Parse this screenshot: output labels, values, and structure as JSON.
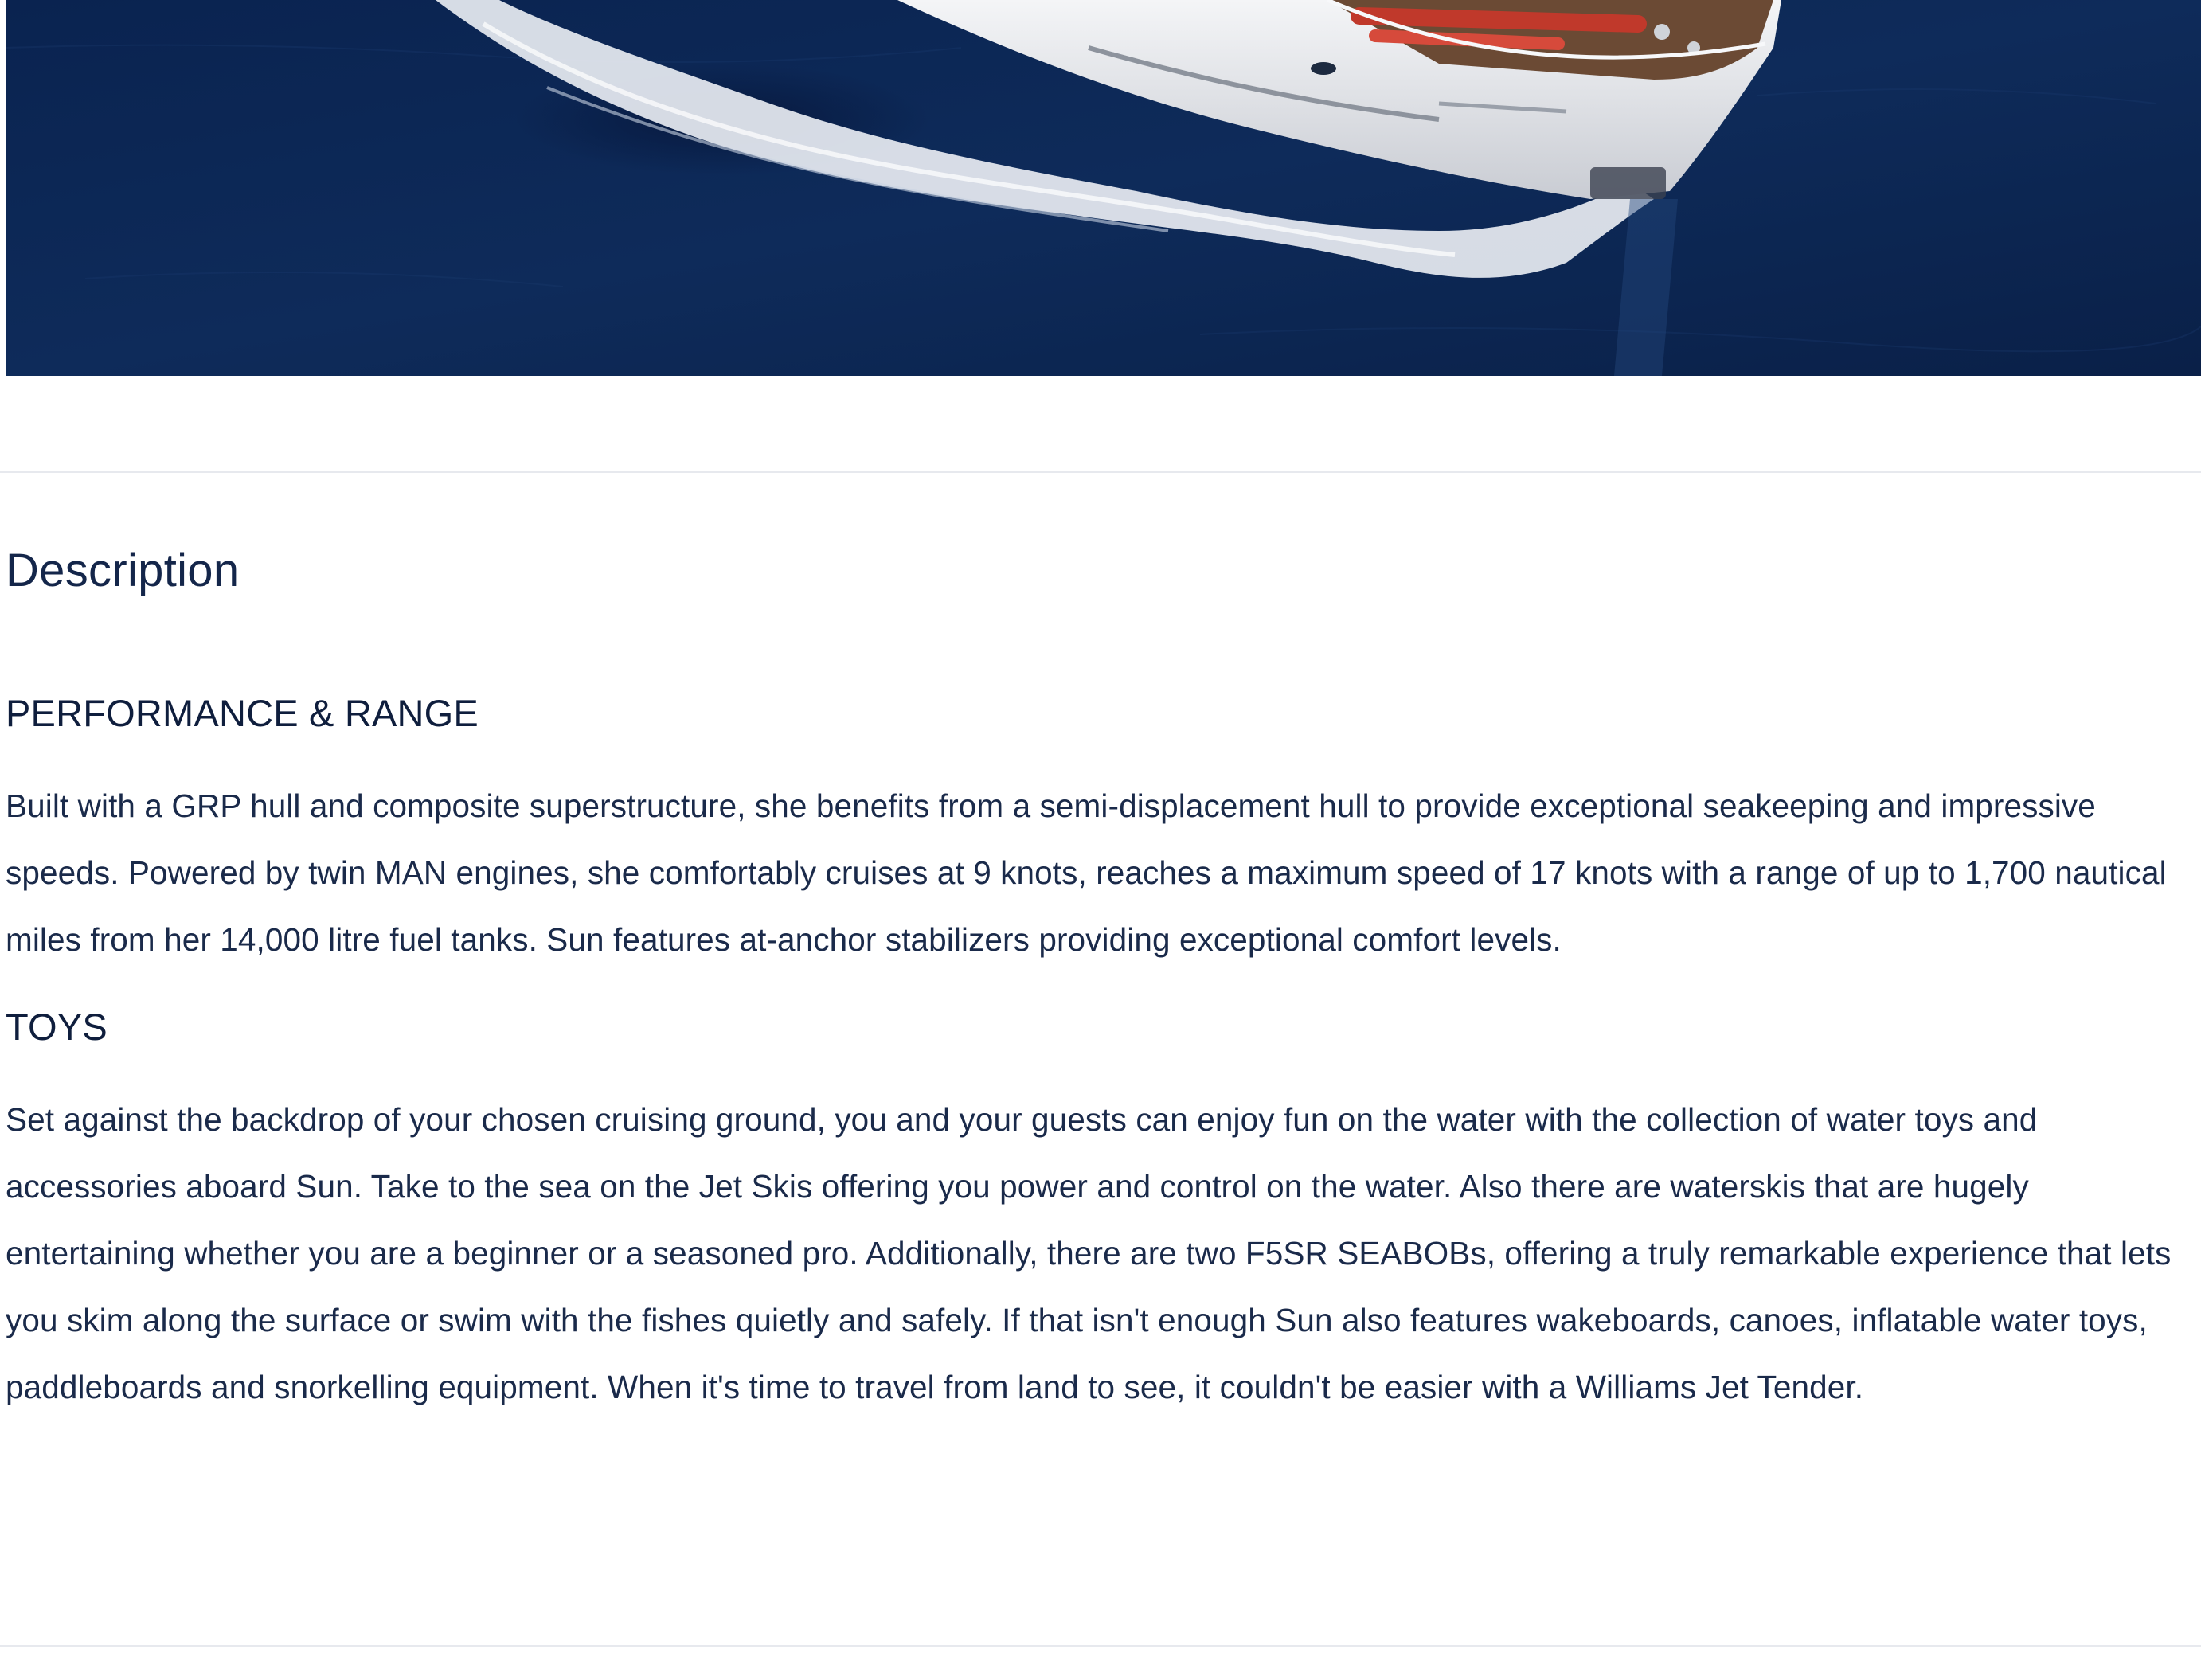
{
  "description": {
    "title": "Description",
    "sections": [
      {
        "heading": "PERFORMANCE & RANGE",
        "body": "Built with a GRP hull and composite superstructure, she benefits from a semi-displacement hull to provide exceptional seakeeping and impressive speeds. Powered by twin MAN engines, she comfortably cruises at 9 knots, reaches a maximum speed of 17 knots with a range of up to 1,700 nautical miles from her 14,000 litre fuel tanks. Sun features at-anchor stabilizers providing exceptional comfort levels."
      },
      {
        "heading": "TOYS",
        "body": "Set against the backdrop of your chosen cruising ground, you and your guests can enjoy fun on the water with the collection of water toys and accessories aboard Sun. Take to the sea on the Jet Skis offering you power and control on the water. Also there are waterskis that are hugely entertaining whether you are a beginner or a seasoned pro. Additionally, there are two F5SR SEABOBs, offering a truly remarkable experience that lets you skim along the surface or swim with the fishes quietly and safely. If that isn't enough Sun also features wakeboards, canoes, inflatable water toys, paddleboards and snorkelling equipment. When it's time to travel from land to see, it couldn't be easier with a Williams Jet Tender."
      }
    ]
  },
  "colors": {
    "sea": "#0d2852",
    "heading_text": "#14264a",
    "body_text": "#1a2a4a",
    "divider": "#e7e9ee"
  }
}
